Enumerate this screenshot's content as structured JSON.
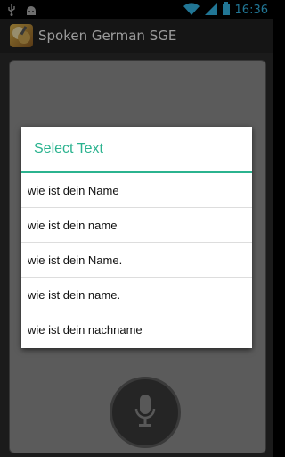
{
  "status_bar": {
    "time": "16:36",
    "icons": [
      "usb-icon",
      "android-icon",
      "wifi-icon",
      "signal-icon",
      "battery-icon"
    ]
  },
  "action_bar": {
    "title": "Spoken German SGE"
  },
  "dialog": {
    "title": "Select Text",
    "items": [
      "wie ist dein Name",
      "wie ist dein name",
      "wie ist dein Name.",
      "wie ist dein name.",
      "wie ist dein nachname"
    ]
  },
  "colors": {
    "accent": "#2bb38f",
    "time": "#33b5e5"
  }
}
